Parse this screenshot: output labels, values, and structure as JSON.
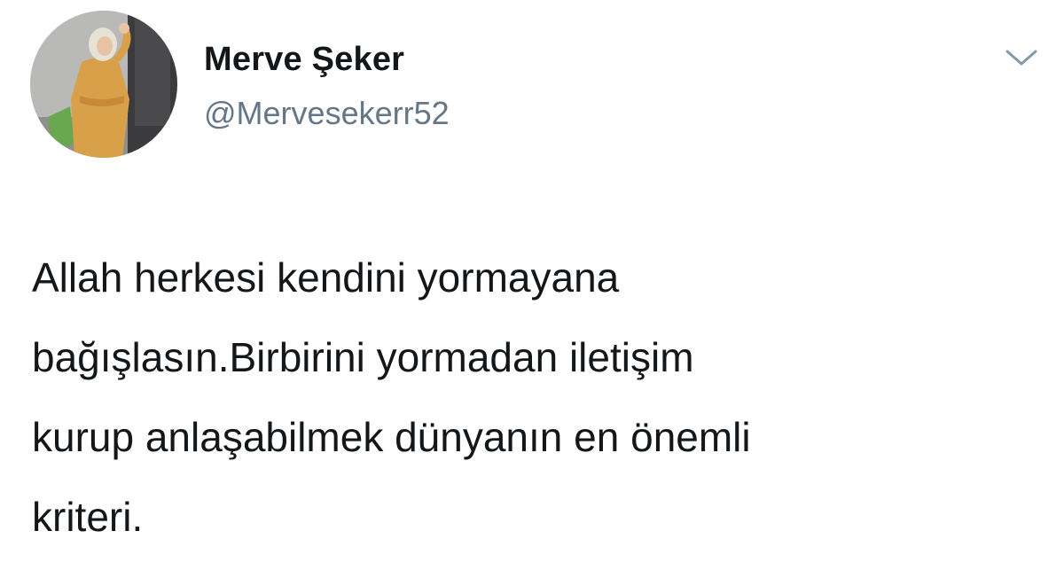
{
  "tweet": {
    "author": {
      "name": "Merve Şeker",
      "handle": "@Mervesekerr52",
      "avatar_icon": "profile-photo"
    },
    "menu_icon": "chevron-down-icon",
    "text": "Allah herkesi kendini yormayana\nbağışlasın.Birbirini yormadan iletişim\nkurup anlaşabilmek dünyanın en önemli\nkriteri."
  },
  "colors": {
    "text": "#14171a",
    "handle": "#657786",
    "caret": "#8899a6",
    "background": "#ffffff"
  }
}
